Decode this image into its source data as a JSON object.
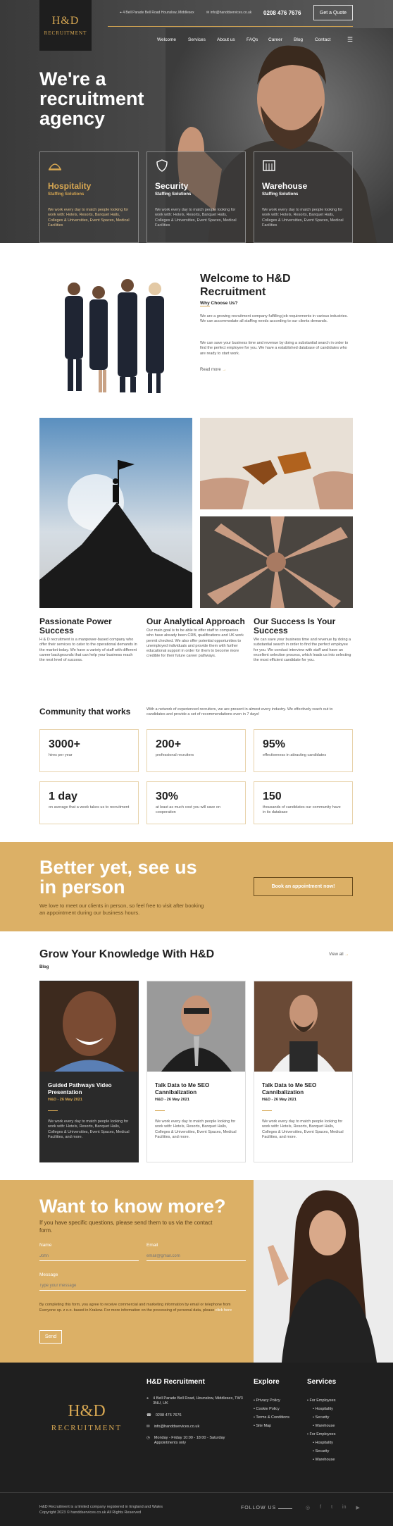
{
  "header": {
    "address": "4 Bell Parade Bell Road Hounslow, Middlesex",
    "email": "info@handdservices.co.uk",
    "phone": "0208 476 7676",
    "quote_button": "Get a Quote",
    "logo_text": "H&D",
    "logo_sub": "RECRUITMENT",
    "nav": [
      "Welcome",
      "Services",
      "About us",
      "FAQs",
      "Career",
      "Blog",
      "Contact"
    ]
  },
  "hero": {
    "title": "We're a recruitment agency",
    "cards": [
      {
        "title": "Hospitality",
        "sub": "Staffing Solutions",
        "text": "We work every day to match people looking for work with: Hotels, Resorts, Banquet Halls, Colleges & Universities, Event Spaces, Medical Facilities",
        "icon": "cloche-icon"
      },
      {
        "title": "Security",
        "sub": "Staffing Solutions",
        "text": "We work every day to match people looking for work with: Hotels, Resorts, Banquet Halls, Colleges & Universities, Event Spaces, Medical Facilities",
        "icon": "shield-icon"
      },
      {
        "title": "Warehouse",
        "sub": "Staffing Solutions",
        "text": "We work every day to match people looking for work with: Hotels, Resorts, Banquet Halls, Colleges & Universities, Event Spaces, Medical Facilities",
        "icon": "warehouse-icon"
      }
    ]
  },
  "welcome": {
    "title": "Welcome to H&D Recruitment",
    "sub": "Why Choose Us?",
    "p1": "We are a growing recruitment company fulfilling job requirements in various industries. We can accommodate all staffing needs according to our clients demands.",
    "p2": "We can save your business time and revenue by doing a substantial search in order to find the perfect employee for you. We have a established database of candidates who are ready to start work.",
    "read_more": "Read more"
  },
  "features": [
    {
      "title": "Passionate Power Success",
      "text": "H & D recruitment is a manpower-based company who offer their services to cater to the operational demands in the market today. We have a variety of staff with different career backgrounds that can help your business reach the next level of success."
    },
    {
      "title": "Our Analytical Approach",
      "text": "Our main goal is to be able to offer staff to companies who have already been CRB, qualifications and UK work permit checked. We also offer potential opportunities to unemployed individuals and provide them with further educational support in order for them to become more credible for their future career pathways."
    },
    {
      "title": "Our Success Is Your Success",
      "text": "We can save your business time and revenue by doing a substantial search in order to find the perfect employee for you. We conduct interview with staff and have an excellent selection process, which leads us into selecting the most efficient candidate for you."
    }
  ],
  "community": {
    "title": "Community that works",
    "text": "With a network of experienced recruiters, we are present in almost every industry. We effectively reach out to candidates and provide a set of recommendations even in 7 days!",
    "stats": [
      {
        "n": "3000+",
        "t": "hires per year"
      },
      {
        "n": "200+",
        "t": "professional recruiters"
      },
      {
        "n": "95%",
        "t": "effectiveness in attracting candidates"
      },
      {
        "n": "1 day",
        "t": "on average that a week takes us to recruitment"
      },
      {
        "n": "30%",
        "t": "at least as much cost you will save on cooperation"
      },
      {
        "n": "150",
        "t": "thousands of candidates our community have in its database"
      }
    ]
  },
  "cta": {
    "title": "Better yet, see us in person",
    "text": "We love to meet our clients in person, so feel free to visit after booking an appointment during our business hours.",
    "button": "Book an appointment now!"
  },
  "blog": {
    "title": "Grow Your Knowledge With H&D",
    "sub": "Blog",
    "view_all": "View all",
    "posts": [
      {
        "title": "Guided Pathways Video Presentation",
        "date": "H&D - 26 May 2021",
        "text": "We work every day to match people looking for work with: Hotels, Resorts, Banquet Halls, Colleges & Universities, Event Spaces, Medical Facilities, and more."
      },
      {
        "title": "Talk Data to Me SEO Cannibalization",
        "date": "H&D - 26 May 2021",
        "text": "We work every day to match people looking for work with: Hotels, Resorts, Banquet Halls, Colleges & Universities, Event Spaces, Medical Facilities, and more."
      },
      {
        "title": "Talk Data to Me SEO Cannibalization",
        "date": "H&D - 26 May 2021",
        "text": "We work every day to match people looking for work with: Hotels, Resorts, Banquet Halls, Colleges & Universities, Event Spaces, Medical Facilities, and more."
      }
    ]
  },
  "contact": {
    "title": "Want to know more?",
    "text": "If you have specific questions, please send them to us via the contact form.",
    "name_label": "Name",
    "name_ph": "John",
    "email_label": "Email",
    "email_ph": "email@gmail.com",
    "message_label": "Message",
    "message_ph": "Type your message",
    "consent": "By completing this form, you agree to receive commercial and marketing information by email or telephone from Everyone sp. z o.o. based in Krakow. For more information on the processing of personal data, please",
    "consent_link": "click here",
    "send": "Send"
  },
  "footer": {
    "company": "H&D Recruitment",
    "address": "4 Bell Parade Bell Road, Hounslow, Middlesex, TW3 3NU, UK",
    "phone": "0208 476 7676",
    "email": "info@handdservices.co.uk",
    "hours": "Monday - Friday 10:00 - 18:00 - Saturday Appointments only",
    "explore_title": "Explore",
    "explore": [
      "Privacy Policy",
      "Cookie Policy",
      "Terms & Conditions",
      "Site Map"
    ],
    "services_title": "Services",
    "for_employees": "For Employees",
    "services": [
      "Hospitality",
      "Security",
      "Warehouse"
    ],
    "copyright1": "H&D Recruitment is a limited company registered in England and Wales",
    "copyright2": "Copyright 2023 © handdservices.co.uk All Rights Reserved",
    "follow": "FOLLOW US"
  },
  "colors": {
    "gold": "#dcb066",
    "dark": "#1f1f1f"
  }
}
